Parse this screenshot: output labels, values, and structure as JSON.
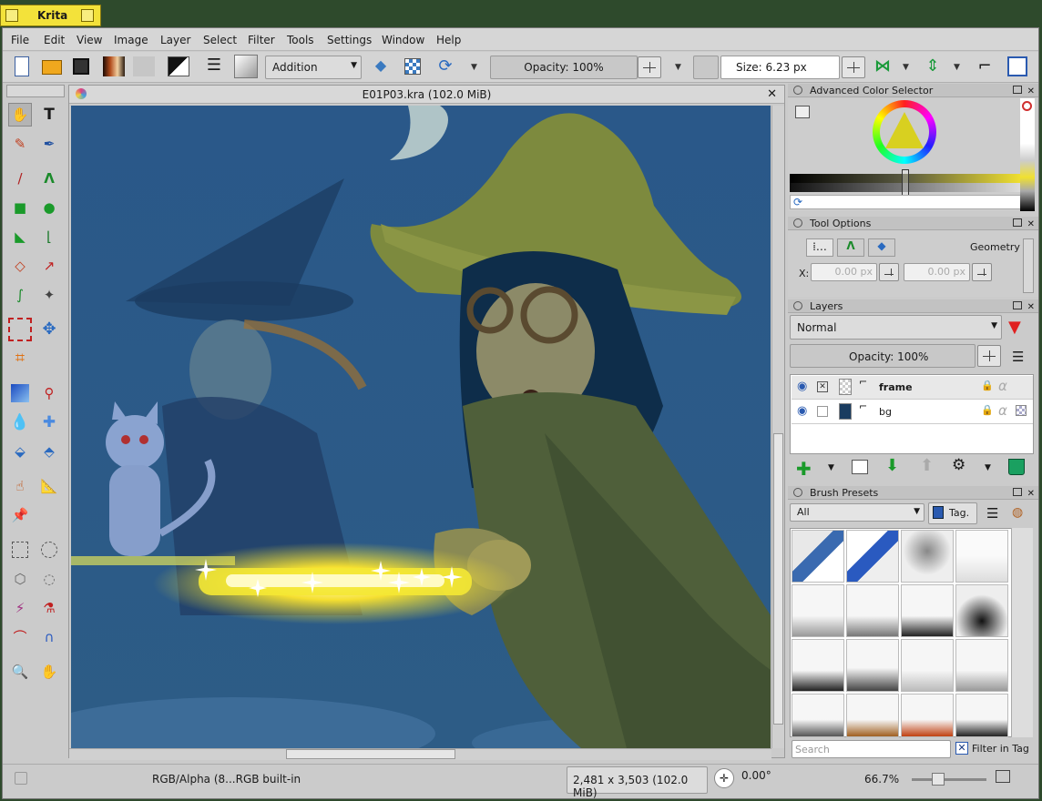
{
  "app_tab": {
    "title": "Krita"
  },
  "menu": [
    "File",
    "Edit",
    "View",
    "Image",
    "Layer",
    "Select",
    "Filter",
    "Tools",
    "Settings",
    "Window",
    "Help"
  ],
  "toolbar": {
    "blend_mode": "Addition",
    "opacity_label": "Opacity: 100%",
    "size_label": "Size: 6.23 px"
  },
  "document": {
    "title": "E01P03.kra (102.0 MiB)"
  },
  "dockers": {
    "color_selector": {
      "title": "Advanced Color Selector"
    },
    "tool_options": {
      "title": "Tool Options",
      "tab_geometry": "Geometry",
      "x_label": "X:",
      "x_value": "0.00 px",
      "y_value": "0.00 px"
    },
    "layers": {
      "title": "Layers",
      "blend": "Normal",
      "opacity": "Opacity:  100%",
      "items": [
        {
          "name": "frame"
        },
        {
          "name": "bg"
        }
      ]
    },
    "brush_presets": {
      "title": "Brush Presets",
      "filter": "All",
      "tag_button": "Tag.",
      "search_placeholder": "Search",
      "filter_in_tag": "Filter in Tag"
    }
  },
  "status": {
    "color_profile": "RGB/Alpha (8...RGB built-in",
    "image_size": "2,481 x 3,503 (102.0 MiB)",
    "rotation": "0.00°",
    "zoom": "66.7%"
  },
  "colors": {
    "accent_yellow": "#f3e23a",
    "canvas_blue": "#2d5b88"
  }
}
